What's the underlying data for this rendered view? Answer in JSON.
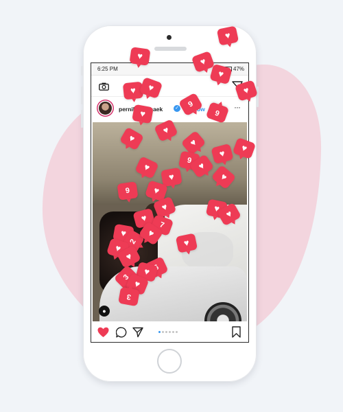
{
  "status_bar": {
    "time": "6:25 PM",
    "battery": "47%",
    "icons": [
      "signal-icon",
      "battery-icon"
    ]
  },
  "top_bar": {
    "icons": [
      "camera-icon",
      "direct-send-icon"
    ]
  },
  "post": {
    "username": "pernilleteisbaek",
    "separator": "•",
    "follow_label": "Follow",
    "more_label": "···",
    "verified": true,
    "tag_icon": "user-tag-icon",
    "tag_glyph": "●"
  },
  "action_bar": {
    "icons": [
      "heart-icon",
      "comment-icon",
      "share-icon",
      "bookmark-icon"
    ],
    "liked": true,
    "carousel_total": 6,
    "carousel_active_index": 0
  },
  "like_badges": {
    "glyph_heart": "♥",
    "numbers": [
      "9",
      "9",
      "6",
      "6",
      "3",
      "3",
      "2",
      "7",
      "9"
    ]
  },
  "colors": {
    "like_red": "#ee3b55",
    "link_blue": "#3897f0",
    "blob_pink": "#f3d5de"
  }
}
